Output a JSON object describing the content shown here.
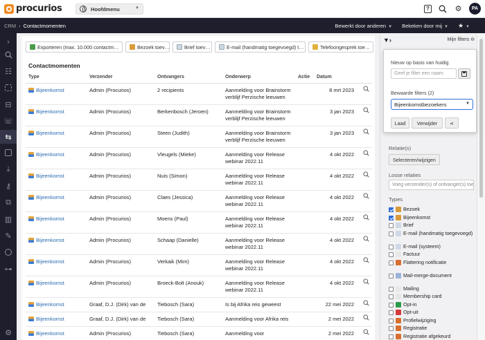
{
  "app": {
    "logo_text": "procurios",
    "main_menu": "Hoofdmenu",
    "user_initials": "PA"
  },
  "breadcrumb": {
    "root": "CRM",
    "current": "Contactmomenten",
    "edited_by": "Bewerkt door anderen",
    "viewed_by": "Bekeken door mij"
  },
  "toolbar": {
    "export": "Exporteren (max. 10.000 contactm…",
    "visit": "Bezoek toev…",
    "letter": "Brief toev…",
    "email": "E-mail (handmatig toegevoegd) t…",
    "phone": "Telefoongesprek toe…"
  },
  "list": {
    "title": "Contactmomenten",
    "columns": [
      "Type",
      "Verzender",
      "Ontvangers",
      "Onderwerp",
      "Actie",
      "Datum"
    ],
    "rows": [
      {
        "type": "Bijeenkomst",
        "sender": "Admin (Procurios)",
        "recipients": "2 recipients",
        "subject": "Aanmelding voor Brainstorm verblijf Perzische leeuwen",
        "date": "8 mrt 2023"
      },
      {
        "type": "Bijeenkomst",
        "sender": "Admin (Procurios)",
        "recipients": "Berkenbosch (Jeroen)",
        "subject": "Aanmelding voor Brainstorm verblijf Perzische leeuwen",
        "date": "3 jan 2023"
      },
      {
        "type": "Bijeenkomst",
        "sender": "Admin (Procurios)",
        "recipients": "Steen (Judith)",
        "subject": "Aanmelding voor Brainstorm verblijf Perzische leeuwen",
        "date": "3 jan 2023"
      },
      {
        "type": "Bijeenkomst",
        "sender": "Admin (Procurios)",
        "recipients": "Vleugels (Mieke)",
        "subject": "Aanmelding voor Release webinar 2022.11",
        "date": "4 okt 2022"
      },
      {
        "type": "Bijeenkomst",
        "sender": "Admin (Procurios)",
        "recipients": "Nuis (Simon)",
        "subject": "Aanmelding voor Release webinar 2022.11",
        "date": "4 okt 2022"
      },
      {
        "type": "Bijeenkomst",
        "sender": "Admin (Procurios)",
        "recipients": "Claes (Jessica)",
        "subject": "Aanmelding voor Release webinar 2022.11",
        "date": "4 okt 2022"
      },
      {
        "type": "Bijeenkomst",
        "sender": "Admin (Procurios)",
        "recipients": "Moens (Paul)",
        "subject": "Aanmelding voor Release webinar 2022.11",
        "date": "4 okt 2022"
      },
      {
        "type": "Bijeenkomst",
        "sender": "Admin (Procurios)",
        "recipients": "Schaap (Danielle)",
        "subject": "Aanmelding voor Release webinar 2022.11",
        "date": "4 okt 2022"
      },
      {
        "type": "Bijeenkomst",
        "sender": "Admin (Procurios)",
        "recipients": "Verkaik (Mim)",
        "subject": "Aanmelding voor Release webinar 2022.11",
        "date": "4 okt 2022"
      },
      {
        "type": "Bijeenkomst",
        "sender": "Admin (Procurios)",
        "recipients": "Broeck-Bolt (Anouk)",
        "subject": "Aanmelding voor Release webinar 2022.11",
        "date": "4 okt 2022"
      },
      {
        "type": "Bijeenkomst",
        "sender": "Graaf, D.J. (Dirk) van de",
        "recipients": "Tiebosch (Sara)",
        "subject": "Is bij Afrika reis geweest",
        "date": "22 mei 2022"
      },
      {
        "type": "Bijeenkomst",
        "sender": "Graaf, D.J. (Dirk) van de",
        "recipients": "Tiebosch (Sara)",
        "subject": "Aanmelding voor Afrika reis",
        "date": "2 mei 2022"
      },
      {
        "type": "Bijeenkomst",
        "sender": "Admin (Procurios)",
        "recipients": "Tiebosch (Sara)",
        "subject": "Aanmelding voor",
        "date": "2 mei 2022"
      }
    ]
  },
  "filters": {
    "my_filters": "Mijn filters",
    "popup": {
      "new_label": "Nieuw op basis van huidig",
      "name_placeholder": "Geef je filter een naam",
      "saved_label": "Bewaarde filters (2)",
      "selected": "Bijeenkomstbezoekers",
      "load": "Laad",
      "delete": "Verwijder"
    },
    "relations_label": "Relatie(s)",
    "select_btn": "Selecteren/wijzigen",
    "loose_label": "Losse relaties",
    "loose_placeholder": "Voeg verzender(s) of ontvanger(s) toe",
    "types_label": "Types",
    "types": [
      {
        "label": "Bezoek",
        "checked": true,
        "color": "#d99a3a"
      },
      {
        "label": "Bijeenkomst",
        "checked": true,
        "color": "#d99a3a"
      },
      {
        "label": "Brief",
        "checked": false,
        "color": "#cfd8e6"
      },
      {
        "label": "E-mail (handmatig toegevoegd)",
        "checked": false,
        "color": "#cfd8e6"
      },
      {
        "label": "E-mail (systeem)",
        "checked": false,
        "color": "#cfd8e6"
      },
      {
        "label": "Factuur",
        "checked": false,
        "color": "#e8e8e8"
      },
      {
        "label": "Flattering notificatie",
        "checked": false,
        "color": "#d96f2f"
      },
      {
        "label": "Mail-merge-document",
        "checked": false,
        "color": "#9ab3d9"
      },
      {
        "label": "Mailing",
        "checked": false,
        "color": "#e8e8e8"
      },
      {
        "label": "Membership card",
        "checked": false,
        "color": "#e6e6e6"
      },
      {
        "label": "Opt-in",
        "checked": false,
        "color": "#2e9b4a"
      },
      {
        "label": "Opt-uit",
        "checked": false,
        "color": "#d23b3b"
      },
      {
        "label": "Profielwijziging",
        "checked": false,
        "color": "#d96f2f"
      },
      {
        "label": "Registratie",
        "checked": false,
        "color": "#d96f2f"
      },
      {
        "label": "Registratie afgekeurd",
        "checked": false,
        "color": "#d96f2f"
      }
    ]
  }
}
